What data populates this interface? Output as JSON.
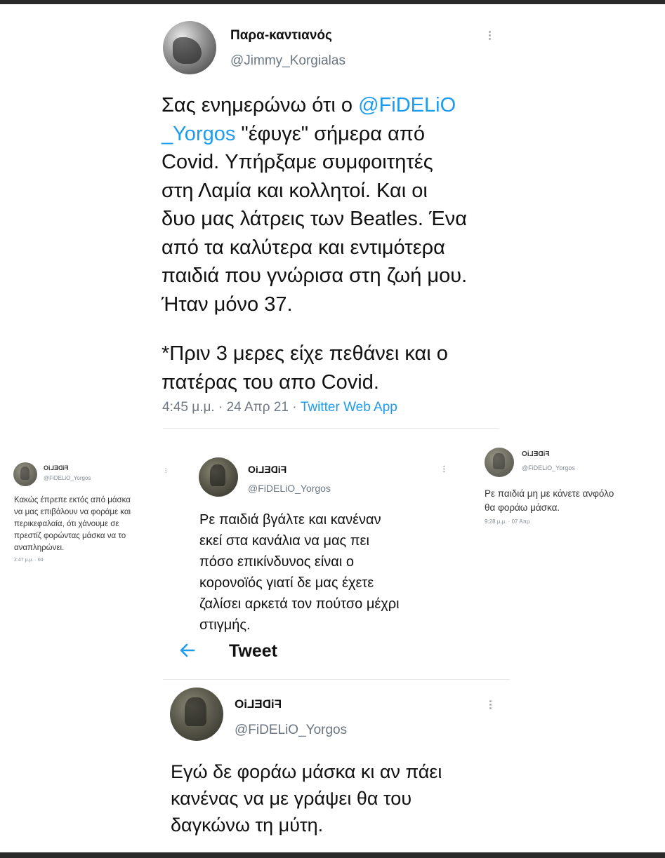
{
  "main_tweet": {
    "display_name": "Παρα-καντιανός",
    "handle": "@Jimmy_Korgialas",
    "text_lines": [
      {
        "before": "Σας ενημερώνω ότι ο ",
        "mention": "@FiDELiO",
        "after": ""
      },
      {
        "before": "",
        "mention": "_Yorgos",
        "after": " \"έφυγε\" σήμερα από"
      },
      {
        "before": "Covid. Υπήρξαμε συμφοιτητές",
        "mention": "",
        "after": ""
      },
      {
        "before": "στη Λαμία και κολλητοί. Και οι",
        "mention": "",
        "after": ""
      },
      {
        "before": "δυο μας λάτρεις των Beatles. Ένα",
        "mention": "",
        "after": ""
      },
      {
        "before": "από τα καλύτερα και εντιμότερα",
        "mention": "",
        "after": ""
      },
      {
        "before": "παιδιά που γνώρισα στη ζωή μου.",
        "mention": "",
        "after": ""
      },
      {
        "before": "Ήταν μόνο 37.",
        "mention": "",
        "after": ""
      }
    ],
    "postscript_lines": [
      "*Πριν 3 μερες είχε πεθάνει και ο",
      "πατέρας του απο Covid."
    ],
    "timestamp": "4:45 μ.μ. · 24 Απρ 21 · ",
    "source": "Twitter Web App"
  },
  "left_tweet": {
    "display_name": "FiDELiO",
    "handle": "@FiDELiO_Yorgos",
    "text_lines": [
      "Κακώς έπρεπε εκτός από μάσκα",
      "να μας επιβάλουν να φοράμε και",
      "περικεφαλαία, ότι χάνουμε σε",
      "πρεστίζ φορώντας μάσκα να το",
      "αναπληρώνει."
    ],
    "timestamp": "2:47 μ.μ. · 04"
  },
  "center_tweet": {
    "display_name": "FiDELiO",
    "handle": "@FiDELiO_Yorgos",
    "text_lines": [
      "Ρε παιδιά βγάλτε και κανέναν",
      "εκεί στα κανάλια να μας πει",
      "πόσο επικίνδυνος είναι ο",
      "κορονοϊός γιατί δε μας έχετε",
      "ζαλίσει αρκετά τον πούτσο μέχρι",
      "στιγμής."
    ]
  },
  "right_tweet": {
    "display_name": "FiDELiO",
    "handle": "@FiDELiO_Yorgos",
    "text_lines": [
      "Ρε παιδιά μη με κάνετε ανφόλο",
      "θα φοράω μάσκα."
    ],
    "timestamp": "9:28 μ.μ. · 07 Απρ"
  },
  "tweet_header": {
    "back_icon": "arrow-left-icon",
    "title": "Tweet"
  },
  "bottom_tweet": {
    "display_name": "FiDELiO",
    "handle": "@FiDELiO_Yorgos",
    "text_lines": [
      "Εγώ δε φοράω μάσκα κι αν πάει",
      "κανένας να με γράψει θα του",
      "δαγκώνω τη μύτη."
    ]
  },
  "colors": {
    "link": "#1d9bf0",
    "frame": "#2a2a2a",
    "handle_gray": "#6b7680"
  }
}
